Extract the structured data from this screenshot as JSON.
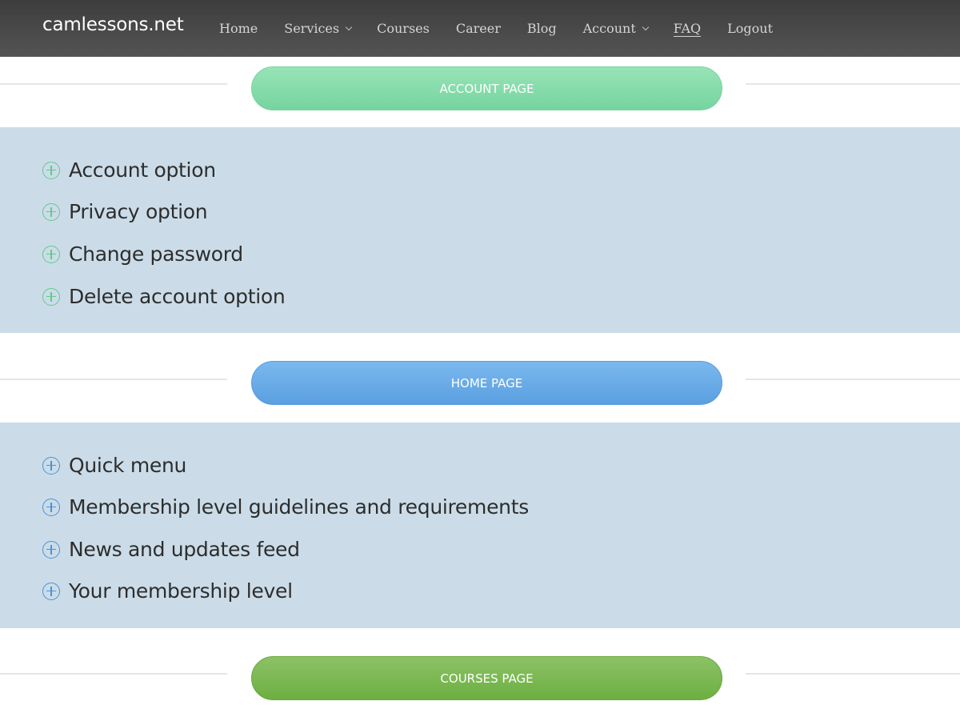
{
  "site": {
    "brand": "camlessons.net"
  },
  "nav": {
    "items": [
      {
        "label": "Home",
        "dropdown": false
      },
      {
        "label": "Services",
        "dropdown": true
      },
      {
        "label": "Courses",
        "dropdown": false
      },
      {
        "label": "Career",
        "dropdown": false
      },
      {
        "label": "Blog",
        "dropdown": false
      },
      {
        "label": "Account",
        "dropdown": true
      },
      {
        "label": "FAQ",
        "dropdown": false
      },
      {
        "label": "Logout",
        "dropdown": false
      }
    ]
  },
  "sections": [
    {
      "title": "ACCOUNT PAGE",
      "color": "#7fd9a5",
      "options": [
        "Account option",
        "Privacy option",
        "Change password",
        "Delete account option"
      ]
    },
    {
      "title": "HOME PAGE",
      "color": "#62a6e6",
      "options": [
        "Quick menu",
        "Membership level guidelines and requirements",
        "News and updates feed",
        "Your membership level"
      ]
    },
    {
      "title": "COURSES PAGE",
      "color": "#74b34a",
      "options": []
    }
  ],
  "colors": {
    "navbar": "#4a4a4a",
    "panel": "#cbdce8",
    "icon_green": "#62c98c",
    "icon_blue": "#4b92d8"
  },
  "icons": [
    "plus-circle-icon",
    "chevron-down-icon"
  ]
}
